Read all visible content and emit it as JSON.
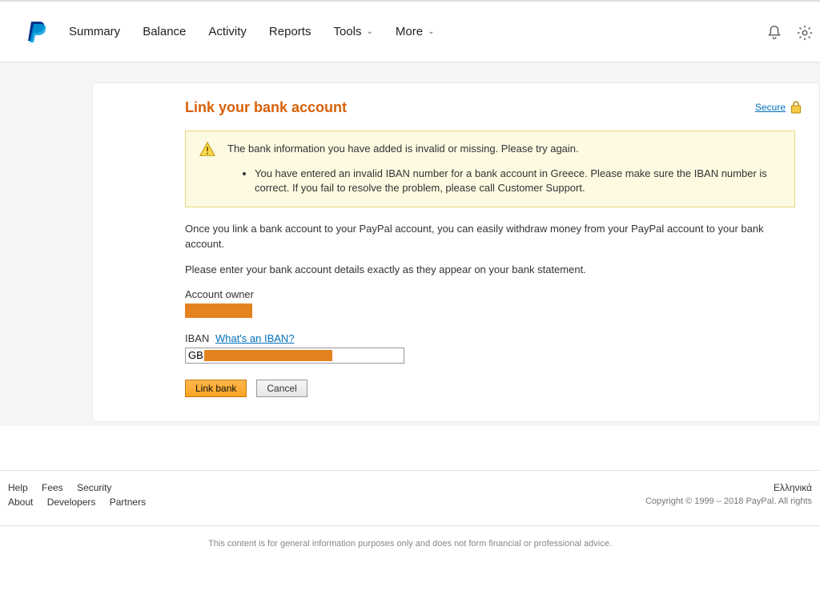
{
  "nav": {
    "items": [
      "Summary",
      "Balance",
      "Activity",
      "Reports",
      "Tools",
      "More"
    ]
  },
  "page": {
    "title": "Link your bank account",
    "secure_label": "Secure",
    "alert_heading": "The bank information you have added is invalid or missing. Please try again.",
    "alert_detail": "You have entered an invalid IBAN number for a bank account in Greece. Please make sure the IBAN number is correct. If you fail to resolve the problem, please call Customer Support.",
    "body1": "Once you link a bank account to your PayPal account, you can easily withdraw money from your PayPal account to your bank account.",
    "body2": "Please enter your bank account details exactly as they appear on your bank statement.",
    "owner_label": "Account owner",
    "iban_label": "IBAN",
    "iban_help": "What's an IBAN?",
    "iban_value": "GB",
    "link_btn": "Link bank",
    "cancel_btn": "Cancel"
  },
  "footer": {
    "row1": [
      "Help",
      "Fees",
      "Security"
    ],
    "row2": [
      "About",
      "Developers",
      "Partners"
    ],
    "lang": "Ελληνικά",
    "copyright": "Copyright © 1999 – 2018 PayPal. All rights",
    "disclaimer": "This content is for general information purposes only and does not form financial or professional advice."
  }
}
